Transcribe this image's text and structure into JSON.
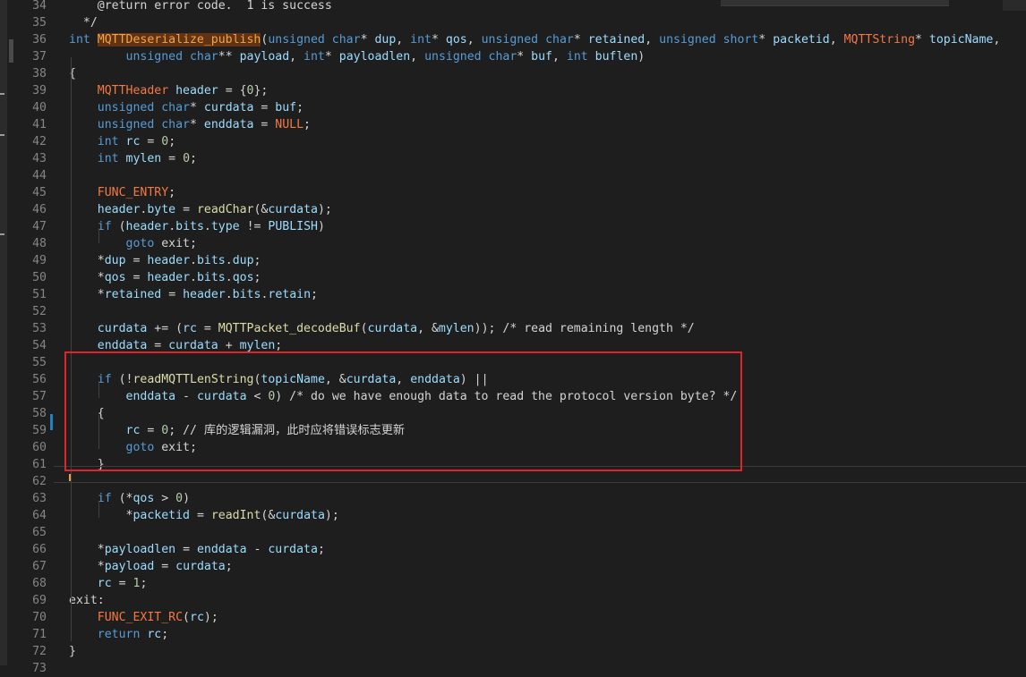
{
  "editor": {
    "lines": [
      {
        "n": "34",
        "tokens": [
          {
            "t": "    @return error code.  1 is success",
            "c": "cm"
          }
        ]
      },
      {
        "n": "35",
        "tokens": [
          {
            "t": "  */",
            "c": "cm"
          }
        ]
      },
      {
        "n": "36",
        "tokens": [
          {
            "t": "int ",
            "c": "ty"
          },
          {
            "t": "MQTTDeserialize_publish",
            "c": "hl-fn"
          },
          {
            "t": "(",
            "c": "pln"
          },
          {
            "t": "unsigned char",
            "c": "ty"
          },
          {
            "t": "* ",
            "c": "op"
          },
          {
            "t": "dup",
            "c": "var"
          },
          {
            "t": ", ",
            "c": "pln"
          },
          {
            "t": "int",
            "c": "ty"
          },
          {
            "t": "* ",
            "c": "op"
          },
          {
            "t": "qos",
            "c": "var"
          },
          {
            "t": ", ",
            "c": "pln"
          },
          {
            "t": "unsigned char",
            "c": "ty"
          },
          {
            "t": "* ",
            "c": "op"
          },
          {
            "t": "retained",
            "c": "var"
          },
          {
            "t": ", ",
            "c": "pln"
          },
          {
            "t": "unsigned short",
            "c": "ty"
          },
          {
            "t": "* ",
            "c": "op"
          },
          {
            "t": "packetid",
            "c": "var"
          },
          {
            "t": ", ",
            "c": "pln"
          },
          {
            "t": "MQTTString",
            "c": "macro"
          },
          {
            "t": "* ",
            "c": "op"
          },
          {
            "t": "topicName",
            "c": "var"
          },
          {
            "t": ",",
            "c": "pln"
          }
        ]
      },
      {
        "n": "37",
        "tokens": [
          {
            "t": "        ",
            "c": "pln"
          },
          {
            "t": "unsigned char",
            "c": "ty"
          },
          {
            "t": "** ",
            "c": "op"
          },
          {
            "t": "payload",
            "c": "var"
          },
          {
            "t": ", ",
            "c": "pln"
          },
          {
            "t": "int",
            "c": "ty"
          },
          {
            "t": "* ",
            "c": "op"
          },
          {
            "t": "payloadlen",
            "c": "var"
          },
          {
            "t": ", ",
            "c": "pln"
          },
          {
            "t": "unsigned char",
            "c": "ty"
          },
          {
            "t": "* ",
            "c": "op"
          },
          {
            "t": "buf",
            "c": "var"
          },
          {
            "t": ", ",
            "c": "pln"
          },
          {
            "t": "int ",
            "c": "ty"
          },
          {
            "t": "buflen",
            "c": "var"
          },
          {
            "t": ")",
            "c": "pln"
          }
        ]
      },
      {
        "n": "38",
        "tokens": [
          {
            "t": "{",
            "c": "pln"
          }
        ]
      },
      {
        "n": "39",
        "tokens": [
          {
            "t": "    ",
            "c": "pln"
          },
          {
            "t": "MQTTHeader ",
            "c": "macro"
          },
          {
            "t": "header",
            "c": "var"
          },
          {
            "t": " = {",
            "c": "op"
          },
          {
            "t": "0",
            "c": "num"
          },
          {
            "t": "};",
            "c": "pln"
          }
        ]
      },
      {
        "n": "40",
        "tokens": [
          {
            "t": "    ",
            "c": "pln"
          },
          {
            "t": "unsigned char",
            "c": "ty"
          },
          {
            "t": "* ",
            "c": "op"
          },
          {
            "t": "curdata",
            "c": "var"
          },
          {
            "t": " = ",
            "c": "op"
          },
          {
            "t": "buf",
            "c": "var"
          },
          {
            "t": ";",
            "c": "pln"
          }
        ]
      },
      {
        "n": "41",
        "tokens": [
          {
            "t": "    ",
            "c": "pln"
          },
          {
            "t": "unsigned char",
            "c": "ty"
          },
          {
            "t": "* ",
            "c": "op"
          },
          {
            "t": "enddata",
            "c": "var"
          },
          {
            "t": " = ",
            "c": "op"
          },
          {
            "t": "NULL",
            "c": "macro"
          },
          {
            "t": ";",
            "c": "pln"
          }
        ]
      },
      {
        "n": "42",
        "tokens": [
          {
            "t": "    ",
            "c": "pln"
          },
          {
            "t": "int ",
            "c": "ty"
          },
          {
            "t": "rc",
            "c": "var"
          },
          {
            "t": " = ",
            "c": "op"
          },
          {
            "t": "0",
            "c": "num"
          },
          {
            "t": ";",
            "c": "pln"
          }
        ]
      },
      {
        "n": "43",
        "tokens": [
          {
            "t": "    ",
            "c": "pln"
          },
          {
            "t": "int ",
            "c": "ty"
          },
          {
            "t": "mylen",
            "c": "var"
          },
          {
            "t": " = ",
            "c": "op"
          },
          {
            "t": "0",
            "c": "num"
          },
          {
            "t": ";",
            "c": "pln"
          }
        ]
      },
      {
        "n": "44",
        "tokens": []
      },
      {
        "n": "45",
        "tokens": [
          {
            "t": "    ",
            "c": "pln"
          },
          {
            "t": "FUNC_ENTRY",
            "c": "macro"
          },
          {
            "t": ";",
            "c": "pln"
          }
        ]
      },
      {
        "n": "46",
        "tokens": [
          {
            "t": "    ",
            "c": "pln"
          },
          {
            "t": "header",
            "c": "var"
          },
          {
            "t": ".",
            "c": "pln"
          },
          {
            "t": "byte",
            "c": "var"
          },
          {
            "t": " = ",
            "c": "op"
          },
          {
            "t": "readChar",
            "c": "fn"
          },
          {
            "t": "(&",
            "c": "pln"
          },
          {
            "t": "curdata",
            "c": "var"
          },
          {
            "t": ");",
            "c": "pln"
          }
        ]
      },
      {
        "n": "47",
        "tokens": [
          {
            "t": "    ",
            "c": "pln"
          },
          {
            "t": "if ",
            "c": "kw"
          },
          {
            "t": "(",
            "c": "pln"
          },
          {
            "t": "header",
            "c": "var"
          },
          {
            "t": ".",
            "c": "pln"
          },
          {
            "t": "bits",
            "c": "var"
          },
          {
            "t": ".",
            "c": "pln"
          },
          {
            "t": "type",
            "c": "var"
          },
          {
            "t": " != ",
            "c": "op"
          },
          {
            "t": "PUBLISH",
            "c": "var"
          },
          {
            "t": ")",
            "c": "pln"
          }
        ]
      },
      {
        "n": "48",
        "tokens": [
          {
            "t": "        ",
            "c": "pln"
          },
          {
            "t": "goto ",
            "c": "kw"
          },
          {
            "t": "exit;",
            "c": "pln"
          }
        ]
      },
      {
        "n": "49",
        "tokens": [
          {
            "t": "    ",
            "c": "pln"
          },
          {
            "t": "*",
            "c": "op"
          },
          {
            "t": "dup",
            "c": "var"
          },
          {
            "t": " = ",
            "c": "op"
          },
          {
            "t": "header",
            "c": "var"
          },
          {
            "t": ".",
            "c": "pln"
          },
          {
            "t": "bits",
            "c": "var"
          },
          {
            "t": ".",
            "c": "pln"
          },
          {
            "t": "dup",
            "c": "var"
          },
          {
            "t": ";",
            "c": "pln"
          }
        ]
      },
      {
        "n": "50",
        "tokens": [
          {
            "t": "    ",
            "c": "pln"
          },
          {
            "t": "*",
            "c": "op"
          },
          {
            "t": "qos",
            "c": "var"
          },
          {
            "t": " = ",
            "c": "op"
          },
          {
            "t": "header",
            "c": "var"
          },
          {
            "t": ".",
            "c": "pln"
          },
          {
            "t": "bits",
            "c": "var"
          },
          {
            "t": ".",
            "c": "pln"
          },
          {
            "t": "qos",
            "c": "var"
          },
          {
            "t": ";",
            "c": "pln"
          }
        ]
      },
      {
        "n": "51",
        "tokens": [
          {
            "t": "    ",
            "c": "pln"
          },
          {
            "t": "*",
            "c": "op"
          },
          {
            "t": "retained",
            "c": "var"
          },
          {
            "t": " = ",
            "c": "op"
          },
          {
            "t": "header",
            "c": "var"
          },
          {
            "t": ".",
            "c": "pln"
          },
          {
            "t": "bits",
            "c": "var"
          },
          {
            "t": ".",
            "c": "pln"
          },
          {
            "t": "retain",
            "c": "var"
          },
          {
            "t": ";",
            "c": "pln"
          }
        ]
      },
      {
        "n": "52",
        "tokens": []
      },
      {
        "n": "53",
        "tokens": [
          {
            "t": "    ",
            "c": "pln"
          },
          {
            "t": "curdata",
            "c": "var"
          },
          {
            "t": " += (",
            "c": "op"
          },
          {
            "t": "rc",
            "c": "var"
          },
          {
            "t": " = ",
            "c": "op"
          },
          {
            "t": "MQTTPacket_decodeBuf",
            "c": "fn"
          },
          {
            "t": "(",
            "c": "pln"
          },
          {
            "t": "curdata",
            "c": "var"
          },
          {
            "t": ", &",
            "c": "pln"
          },
          {
            "t": "mylen",
            "c": "var"
          },
          {
            "t": ")); /* read remaining length */",
            "c": "cm"
          }
        ]
      },
      {
        "n": "54",
        "tokens": [
          {
            "t": "    ",
            "c": "pln"
          },
          {
            "t": "enddata",
            "c": "var"
          },
          {
            "t": " = ",
            "c": "op"
          },
          {
            "t": "curdata",
            "c": "var"
          },
          {
            "t": " + ",
            "c": "op"
          },
          {
            "t": "mylen",
            "c": "var"
          },
          {
            "t": ";",
            "c": "pln"
          }
        ]
      },
      {
        "n": "55",
        "tokens": []
      },
      {
        "n": "56",
        "tokens": [
          {
            "t": "    ",
            "c": "pln"
          },
          {
            "t": "if ",
            "c": "kw"
          },
          {
            "t": "(!",
            "c": "pln"
          },
          {
            "t": "readMQTTLenString",
            "c": "fn"
          },
          {
            "t": "(",
            "c": "pln"
          },
          {
            "t": "topicName",
            "c": "var"
          },
          {
            "t": ", &",
            "c": "pln"
          },
          {
            "t": "curdata",
            "c": "var"
          },
          {
            "t": ", ",
            "c": "pln"
          },
          {
            "t": "enddata",
            "c": "var"
          },
          {
            "t": ") ||",
            "c": "pln"
          }
        ]
      },
      {
        "n": "57",
        "tokens": [
          {
            "t": "        ",
            "c": "pln"
          },
          {
            "t": "enddata",
            "c": "var"
          },
          {
            "t": " - ",
            "c": "op"
          },
          {
            "t": "curdata",
            "c": "var"
          },
          {
            "t": " < ",
            "c": "op"
          },
          {
            "t": "0",
            "c": "num"
          },
          {
            "t": ") /* do we have enough data to read the protocol version byte? */",
            "c": "cm"
          }
        ]
      },
      {
        "n": "58",
        "tokens": [
          {
            "t": "    {",
            "c": "pln"
          }
        ]
      },
      {
        "n": "59",
        "tokens": [
          {
            "t": "        ",
            "c": "pln"
          },
          {
            "t": "rc",
            "c": "var"
          },
          {
            "t": " = ",
            "c": "op"
          },
          {
            "t": "0",
            "c": "num"
          },
          {
            "t": "; // 库的逻辑漏洞，此时应将错误标志更新",
            "c": "cm"
          }
        ]
      },
      {
        "n": "60",
        "tokens": [
          {
            "t": "        ",
            "c": "pln"
          },
          {
            "t": "goto ",
            "c": "kw"
          },
          {
            "t": "exit;",
            "c": "pln"
          }
        ]
      },
      {
        "n": "61",
        "tokens": [
          {
            "t": "    }",
            "c": "pln"
          }
        ]
      },
      {
        "n": "62",
        "tokens": []
      },
      {
        "n": "63",
        "tokens": [
          {
            "t": "    ",
            "c": "pln"
          },
          {
            "t": "if ",
            "c": "kw"
          },
          {
            "t": "(*",
            "c": "pln"
          },
          {
            "t": "qos",
            "c": "var"
          },
          {
            "t": " > ",
            "c": "op"
          },
          {
            "t": "0",
            "c": "num"
          },
          {
            "t": ")",
            "c": "pln"
          }
        ]
      },
      {
        "n": "64",
        "tokens": [
          {
            "t": "        ",
            "c": "pln"
          },
          {
            "t": "*",
            "c": "op"
          },
          {
            "t": "packetid",
            "c": "var"
          },
          {
            "t": " = ",
            "c": "op"
          },
          {
            "t": "readInt",
            "c": "fn"
          },
          {
            "t": "(&",
            "c": "pln"
          },
          {
            "t": "curdata",
            "c": "var"
          },
          {
            "t": ");",
            "c": "pln"
          }
        ]
      },
      {
        "n": "65",
        "tokens": []
      },
      {
        "n": "66",
        "tokens": [
          {
            "t": "    ",
            "c": "pln"
          },
          {
            "t": "*",
            "c": "op"
          },
          {
            "t": "payloadlen",
            "c": "var"
          },
          {
            "t": " = ",
            "c": "op"
          },
          {
            "t": "enddata",
            "c": "var"
          },
          {
            "t": " - ",
            "c": "op"
          },
          {
            "t": "curdata",
            "c": "var"
          },
          {
            "t": ";",
            "c": "pln"
          }
        ]
      },
      {
        "n": "67",
        "tokens": [
          {
            "t": "    ",
            "c": "pln"
          },
          {
            "t": "*",
            "c": "op"
          },
          {
            "t": "payload",
            "c": "var"
          },
          {
            "t": " = ",
            "c": "op"
          },
          {
            "t": "curdata",
            "c": "var"
          },
          {
            "t": ";",
            "c": "pln"
          }
        ]
      },
      {
        "n": "68",
        "tokens": [
          {
            "t": "    ",
            "c": "pln"
          },
          {
            "t": "rc",
            "c": "var"
          },
          {
            "t": " = ",
            "c": "op"
          },
          {
            "t": "1",
            "c": "num"
          },
          {
            "t": ";",
            "c": "pln"
          }
        ]
      },
      {
        "n": "69",
        "tokens": [
          {
            "t": "exit:",
            "c": "pln"
          }
        ]
      },
      {
        "n": "70",
        "tokens": [
          {
            "t": "    ",
            "c": "pln"
          },
          {
            "t": "FUNC_EXIT_RC",
            "c": "macro"
          },
          {
            "t": "(",
            "c": "pln"
          },
          {
            "t": "rc",
            "c": "var"
          },
          {
            "t": ");",
            "c": "pln"
          }
        ]
      },
      {
        "n": "71",
        "tokens": [
          {
            "t": "    ",
            "c": "pln"
          },
          {
            "t": "return ",
            "c": "kw"
          },
          {
            "t": "rc",
            "c": "var"
          },
          {
            "t": ";",
            "c": "pln"
          }
        ]
      },
      {
        "n": "72",
        "tokens": [
          {
            "t": "}",
            "c": "pln"
          }
        ]
      },
      {
        "n": "73",
        "tokens": []
      }
    ]
  },
  "colors": {
    "background": "#1e1e1e",
    "highlight_box": "#e0242b",
    "git_modified": "#1f81c6"
  }
}
